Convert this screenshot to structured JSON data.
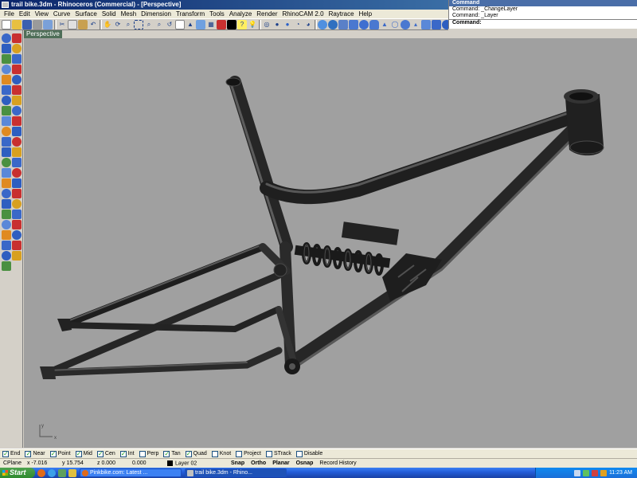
{
  "window": {
    "title": "trail bike.3dm - Rhinoceros (Commercial) - [Perspective]"
  },
  "menu": [
    "File",
    "Edit",
    "View",
    "Curve",
    "Surface",
    "Solid",
    "Mesh",
    "Dimension",
    "Transform",
    "Tools",
    "Analyze",
    "Render",
    "RhinoCAM 2.0",
    "Raytrace",
    "Help"
  ],
  "command": {
    "header": "Command",
    "history": [
      "Command: _ChangeLayer",
      "Command: _Layer"
    ],
    "prompt": "Command:"
  },
  "viewport": {
    "tab": "Perspective",
    "axis_y": "y",
    "axis_x": "x"
  },
  "osnap": [
    {
      "label": "End",
      "checked": true
    },
    {
      "label": "Near",
      "checked": true
    },
    {
      "label": "Point",
      "checked": true
    },
    {
      "label": "Mid",
      "checked": true
    },
    {
      "label": "Cen",
      "checked": true
    },
    {
      "label": "Int",
      "checked": true
    },
    {
      "label": "Perp",
      "checked": false
    },
    {
      "label": "Tan",
      "checked": true
    },
    {
      "label": "Quad",
      "checked": true
    },
    {
      "label": "Knot",
      "checked": false
    },
    {
      "label": "Project",
      "checked": false
    },
    {
      "label": "STrack",
      "checked": false
    },
    {
      "label": "Disable",
      "checked": false
    }
  ],
  "status": {
    "cplane": "CPlane",
    "x": "x -7.016",
    "y": "y 15.754",
    "z": "z 0.000",
    "extra": "0.000",
    "layer": "Layer 02",
    "panes": [
      "Snap",
      "Ortho",
      "Planar",
      "Osnap",
      "Record History"
    ]
  },
  "taskbar": {
    "start": "Start",
    "tasks": [
      "Pinkbike.com: Latest ...",
      "trail bike.3dm - Rhino..."
    ],
    "clock": "11:23 AM"
  },
  "colors": {
    "viewport_bg": "#a0a0a0",
    "frame": "#2b2b2b",
    "title_bar": "#0a246a",
    "viewport_tab": "#4e6e58"
  }
}
